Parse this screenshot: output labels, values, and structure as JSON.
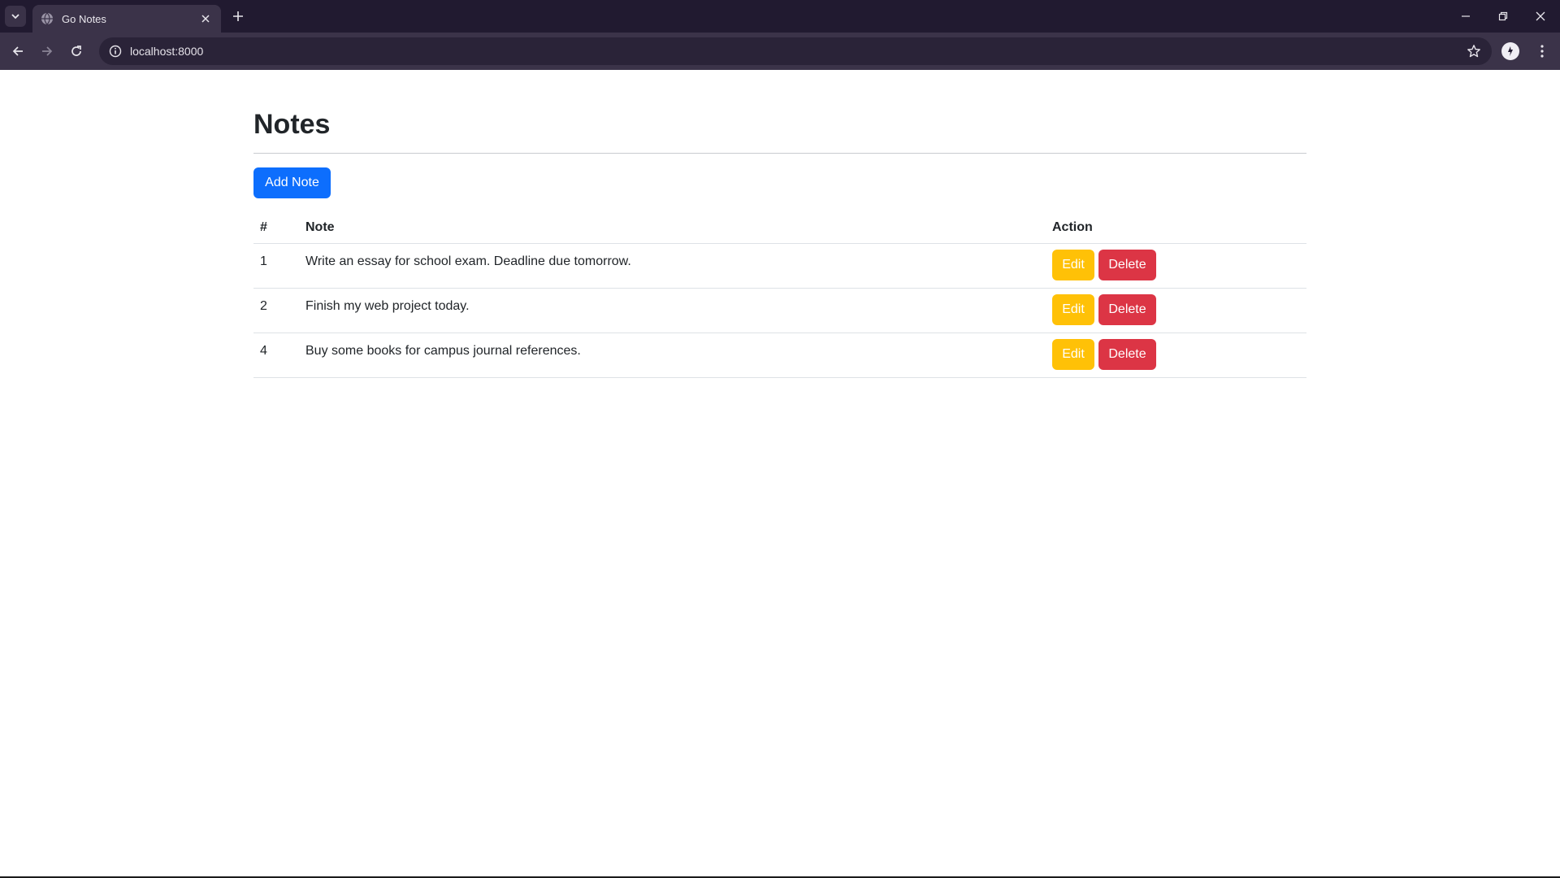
{
  "browser": {
    "tab_title": "Go Notes",
    "url": "localhost:8000"
  },
  "page": {
    "title": "Notes",
    "add_button": "Add Note",
    "table": {
      "headers": [
        "#",
        "Note",
        "Action"
      ],
      "rows": [
        {
          "id": "1",
          "note": "Write an essay for school exam. Deadline due tomorrow.",
          "edit": "Edit",
          "delete": "Delete"
        },
        {
          "id": "2",
          "note": "Finish my web project today.",
          "edit": "Edit",
          "delete": "Delete"
        },
        {
          "id": "4",
          "note": "Buy some books for campus journal references.",
          "edit": "Edit",
          "delete": "Delete"
        }
      ]
    }
  },
  "colors": {
    "primary": "#0d6efd",
    "warning": "#ffc107",
    "danger": "#dc3545",
    "chrome_bg": "#211a30"
  }
}
